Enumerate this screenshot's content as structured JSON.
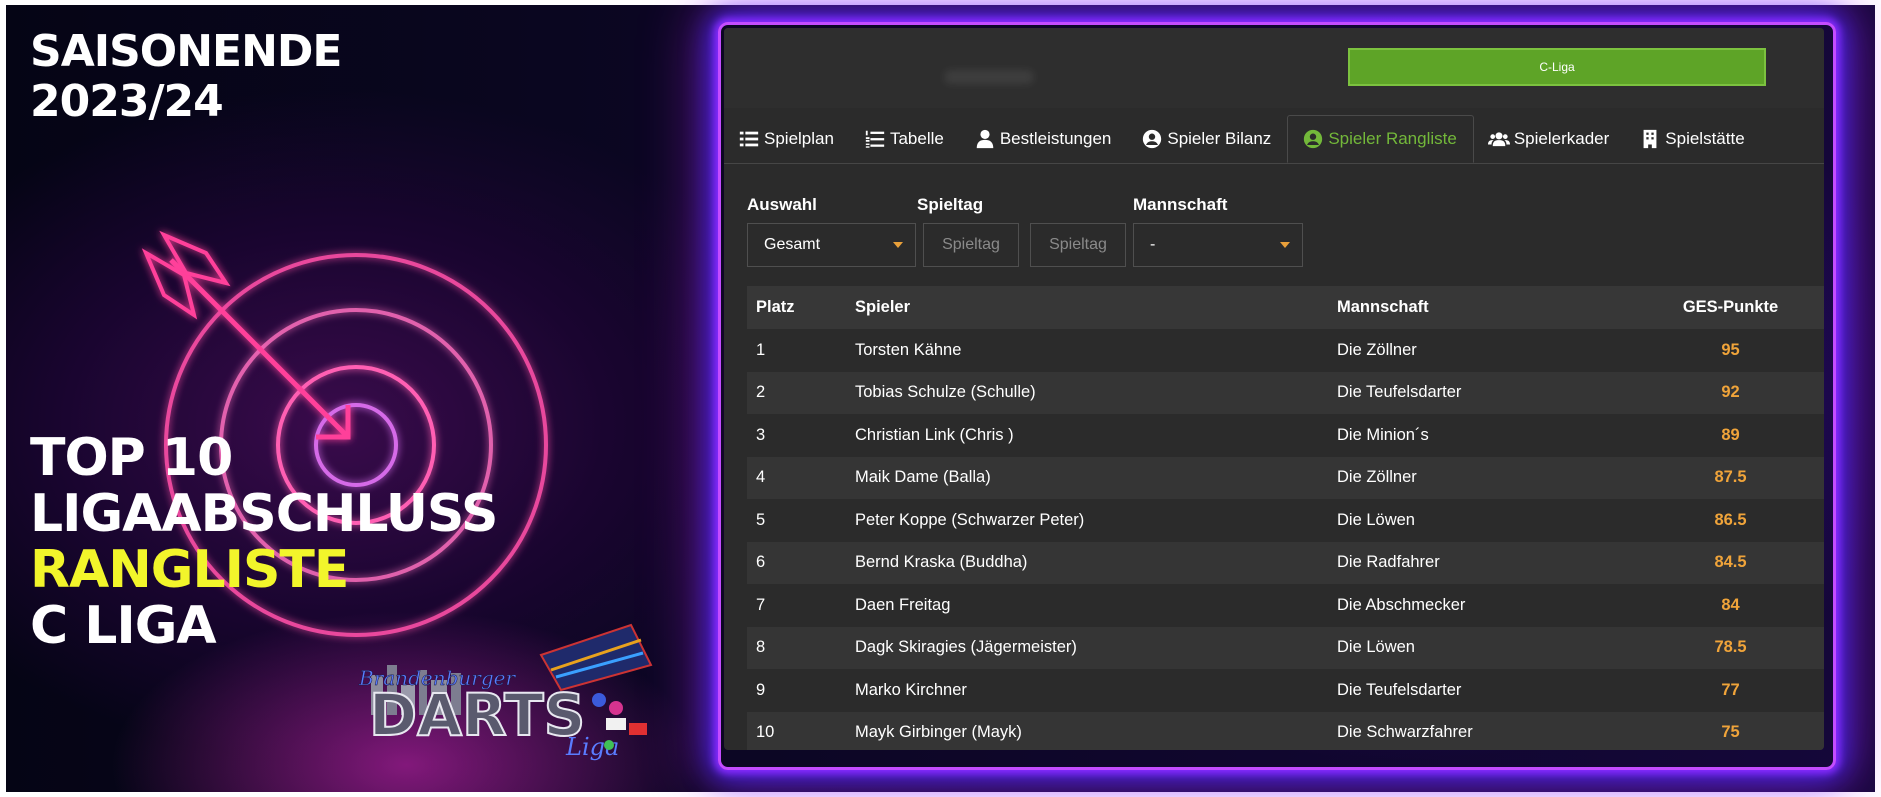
{
  "poster": {
    "season_line1": "SAISONENDE",
    "season_line2": "2023/24",
    "title_line1": "TOP 10",
    "title_line2": "LIGAABSCHLUSS",
    "title_line3": "RANGLISTE",
    "title_line4": "C LIGA",
    "accent_color": "#f2f52b",
    "glow_color": "#c44cff",
    "logo_text_1": "Brandenburger",
    "logo_text_2": "DARTS",
    "logo_text_3": "Liga"
  },
  "panel": {
    "league_badge": "C-Liga",
    "tabs": [
      {
        "label": "Spielplan",
        "icon": "list-icon",
        "active": false
      },
      {
        "label": "Tabelle",
        "icon": "numbered-list-icon",
        "active": false
      },
      {
        "label": "Bestleistungen",
        "icon": "user-icon",
        "active": false
      },
      {
        "label": "Spieler Bilanz",
        "icon": "user-circle-icon",
        "active": false
      },
      {
        "label": "Spieler Rangliste",
        "icon": "user-circle-icon",
        "active": true
      },
      {
        "label": "Spielerkader",
        "icon": "users-icon",
        "active": false
      },
      {
        "label": "Spielstätte",
        "icon": "building-icon",
        "active": false
      }
    ],
    "active_color": "#73b83a",
    "filters": {
      "auswahl_label": "Auswahl",
      "auswahl_value": "Gesamt",
      "spieltag_label": "Spieltag",
      "spieltag_from_placeholder": "Spieltag",
      "spieltag_to_placeholder": "Spieltag",
      "mannschaft_label": "Mannschaft",
      "mannschaft_value": "-"
    },
    "table": {
      "headers": [
        "Platz",
        "Spieler",
        "Mannschaft",
        "GES-Punkte"
      ],
      "rows": [
        [
          "1",
          "Torsten Kähne",
          "Die Zöllner",
          "95"
        ],
        [
          "2",
          "Tobias Schulze (Schulle)",
          "Die Teufelsdarter",
          "92"
        ],
        [
          "3",
          "Christian Link (Chris )",
          "Die Minion´s",
          "89"
        ],
        [
          "4",
          "Maik Dame (Balla)",
          "Die Zöllner",
          "87.5"
        ],
        [
          "5",
          "Peter Koppe (Schwarzer Peter)",
          "Die Löwen",
          "86.5"
        ],
        [
          "6",
          "Bernd Kraska (Buddha)",
          "Die Radfahrer",
          "84.5"
        ],
        [
          "7",
          "Daen Freitag",
          "Die Abschmecker",
          "84"
        ],
        [
          "8",
          "Dagk Skiragies (Jägermeister)",
          "Die Löwen",
          "78.5"
        ],
        [
          "9",
          "Marko Kirchner",
          "Die Teufelsdarter",
          "77"
        ],
        [
          "10",
          "Mayk Girbinger (Mayk)",
          "Die Schwarzfahrer",
          "75"
        ]
      ],
      "points_color": "#f0a43a"
    }
  }
}
